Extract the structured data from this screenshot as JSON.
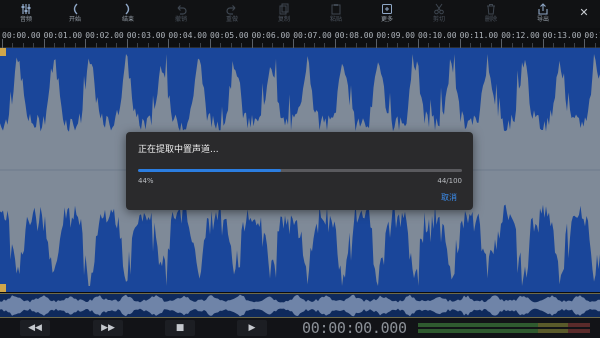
{
  "toolbar": {
    "items": [
      {
        "label": "音频",
        "icon": "equalizer-icon",
        "enabled": true
      },
      {
        "label": "开始",
        "icon": "bracket-left-icon",
        "enabled": true
      },
      {
        "label": "结束",
        "icon": "bracket-right-icon",
        "enabled": true
      },
      {
        "label": "撤销",
        "icon": "undo-icon",
        "enabled": false
      },
      {
        "label": "重做",
        "icon": "redo-icon",
        "enabled": false
      },
      {
        "label": "复制",
        "icon": "copy-icon",
        "enabled": false
      },
      {
        "label": "粘贴",
        "icon": "paste-icon",
        "enabled": false
      },
      {
        "label": "更多",
        "icon": "more-icon",
        "enabled": true
      },
      {
        "label": "剪切",
        "icon": "cut-icon",
        "enabled": false
      },
      {
        "label": "删除",
        "icon": "trash-icon",
        "enabled": false
      },
      {
        "label": "导出",
        "icon": "export-icon",
        "enabled": true
      }
    ],
    "close_icon": "close-icon",
    "close_glyph": "✕"
  },
  "timeline": {
    "ticks": [
      "00:00.00",
      "00:01.00",
      "00:02.00",
      "00:03.00",
      "00:04.00",
      "00:05.00",
      "00:06.00",
      "00:07.00",
      "00:08.00",
      "00:09.00",
      "00:10.00",
      "00:11.00",
      "00:12.00",
      "00:13.00",
      "00:14.00"
    ]
  },
  "transport": {
    "rewind_glyph": "◀◀",
    "forward_glyph": "▶▶",
    "stop_glyph": "■",
    "play_glyph": "▶",
    "timecode": "00:00:00.000"
  },
  "dialog": {
    "title": "正在提取中置声道...",
    "progress": 0.44,
    "percent_label": "44%",
    "count_label": "44/100",
    "cancel_label": "取消"
  },
  "colors": {
    "wave_bg": "#1a469a",
    "wave_fill": "#7f8a98",
    "accent": "#2b7de0",
    "cancel": "#3b8ef0"
  }
}
